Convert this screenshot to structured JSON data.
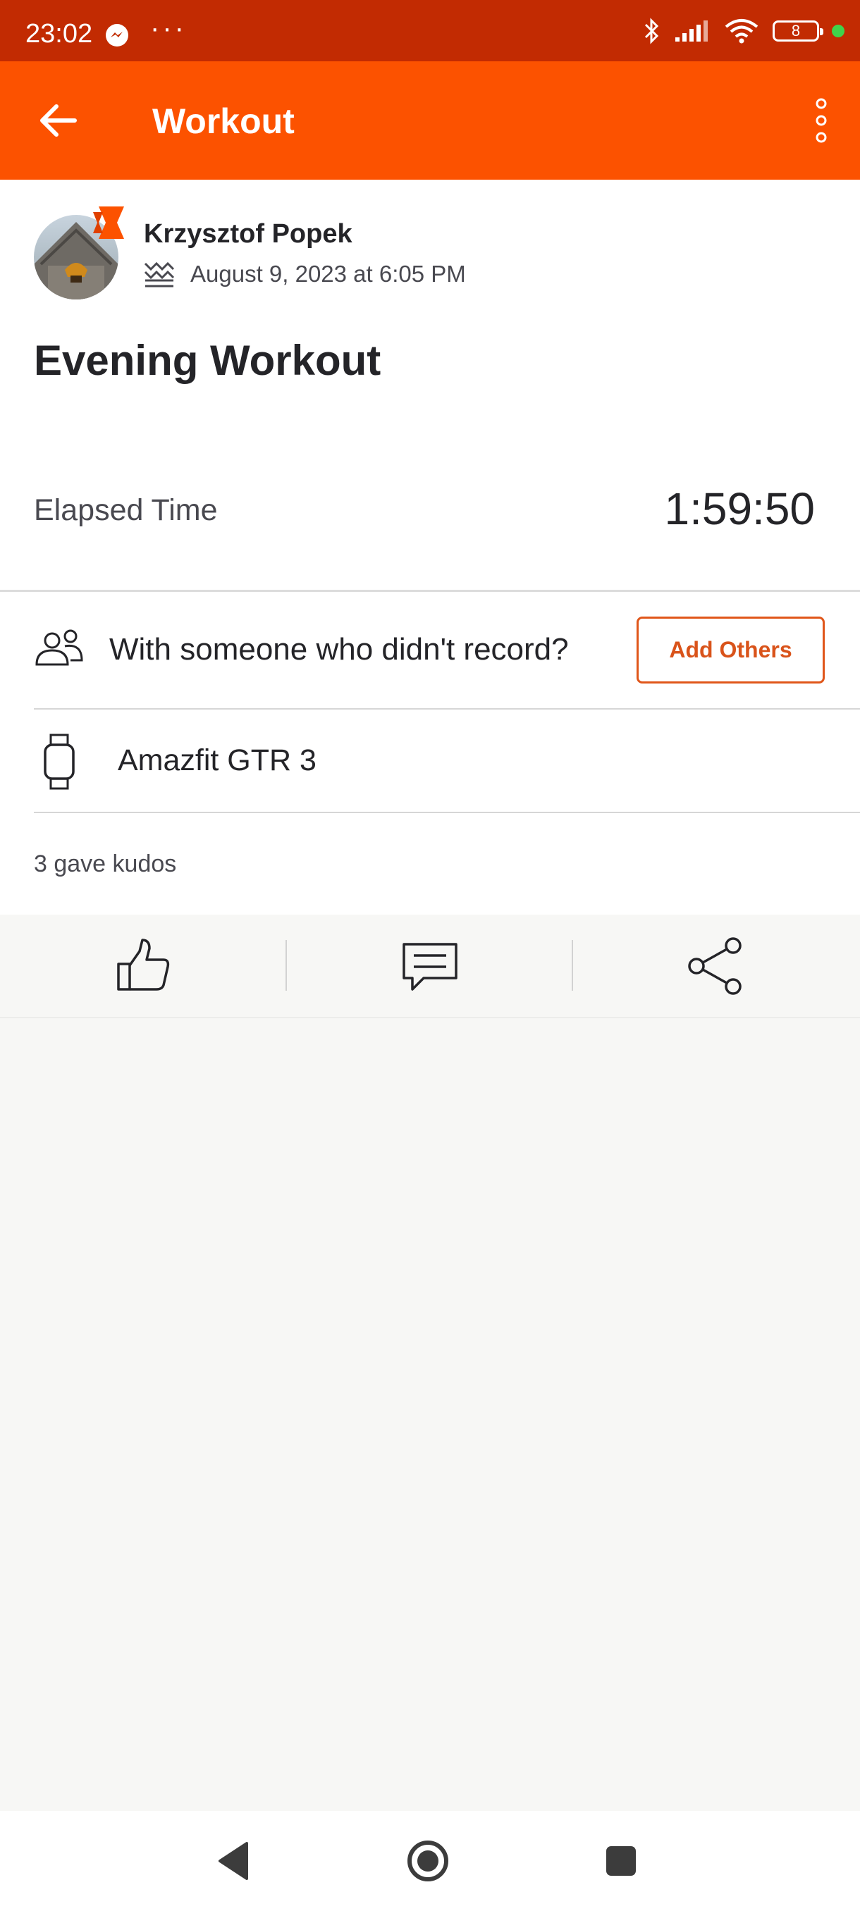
{
  "status_bar": {
    "time": "23:02",
    "dots": "···",
    "battery": "8",
    "icons": [
      "messenger-icon",
      "bluetooth-icon",
      "signal-icon",
      "wifi-icon",
      "battery-icon",
      "charging-dot-icon"
    ]
  },
  "app_bar": {
    "title": "Workout",
    "back_icon": "arrow-left-icon",
    "more_icon": "more-vertical-icon",
    "background": "#fc5200"
  },
  "activity": {
    "athlete_name": "Krzysztof Popek",
    "date": "August 9, 2023 at 6:05 PM",
    "title": "Evening Workout",
    "stat_label": "Elapsed Time",
    "stat_value": "1:59:50"
  },
  "with_others": {
    "prompt": "With someone who didn't record?",
    "button_label": "Add Others"
  },
  "device": {
    "name": "Amazfit GTR 3"
  },
  "kudos": {
    "text": "3 gave kudos"
  },
  "actions": [
    "thumbs-up-icon",
    "comment-icon",
    "share-icon"
  ],
  "nav": [
    "back-triangle-icon",
    "home-circle-icon",
    "recents-square-icon"
  ]
}
